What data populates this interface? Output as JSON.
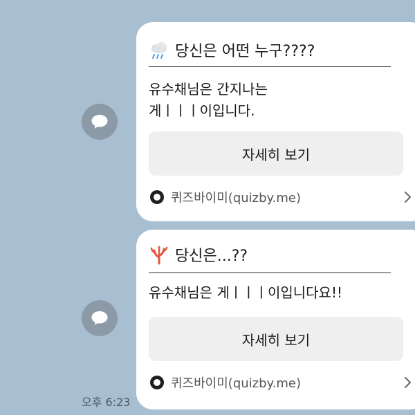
{
  "messages": [
    {
      "title": "당신은 어떤 누구????",
      "title_emoji": "cloud-rain-icon",
      "desc_lines": [
        "유수채님은 간지나는",
        "게ㅣㅣㅣ이입니다."
      ],
      "button_label": "자세히 보기",
      "source": "퀴즈바이미(quizby.me)"
    },
    {
      "title": "당신은...??",
      "title_emoji": "coral-icon",
      "desc_lines": [
        "유수채님은 게ㅣㅣㅣ이입니다요!!"
      ],
      "button_label": "자세히 보기",
      "source": "퀴즈바이미(quizby.me)"
    }
  ],
  "timestamp": "오후 6:23",
  "colors": {
    "chat_background": "#a8bed1",
    "bubble": "#ffffff",
    "button": "#efefef",
    "share_icon": "#8c9aa7"
  }
}
